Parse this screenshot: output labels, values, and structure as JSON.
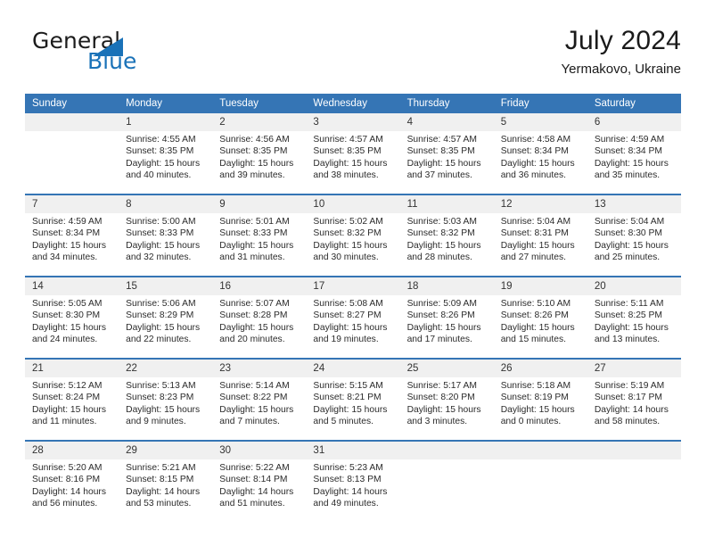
{
  "brand": {
    "word1": "General",
    "word2": "Blue",
    "triangle_color": "#1a72b8",
    "blue_color": "#1a72b8"
  },
  "header": {
    "month_title": "July 2024",
    "location": "Yermakovo, Ukraine"
  },
  "theme": {
    "header_row_bg": "#3575b5",
    "date_band_bg": "#f0f0f0",
    "cell_bg": "#ffffff",
    "text_color": "#2b2b2b"
  },
  "calendar": {
    "weekday_headers": [
      "Sunday",
      "Monday",
      "Tuesday",
      "Wednesday",
      "Thursday",
      "Friday",
      "Saturday"
    ],
    "labels": {
      "sunrise": "Sunrise:",
      "sunset": "Sunset:",
      "daylight": "Daylight:"
    },
    "weeks": [
      [
        {
          "day": "",
          "blank": true,
          "l1": "",
          "l2": "",
          "l3": "",
          "l4": ""
        },
        {
          "day": "1",
          "l1": "Sunrise: 4:55 AM",
          "l2": "Sunset: 8:35 PM",
          "l3": "Daylight: 15 hours",
          "l4": "and 40 minutes."
        },
        {
          "day": "2",
          "l1": "Sunrise: 4:56 AM",
          "l2": "Sunset: 8:35 PM",
          "l3": "Daylight: 15 hours",
          "l4": "and 39 minutes."
        },
        {
          "day": "3",
          "l1": "Sunrise: 4:57 AM",
          "l2": "Sunset: 8:35 PM",
          "l3": "Daylight: 15 hours",
          "l4": "and 38 minutes."
        },
        {
          "day": "4",
          "l1": "Sunrise: 4:57 AM",
          "l2": "Sunset: 8:35 PM",
          "l3": "Daylight: 15 hours",
          "l4": "and 37 minutes."
        },
        {
          "day": "5",
          "l1": "Sunrise: 4:58 AM",
          "l2": "Sunset: 8:34 PM",
          "l3": "Daylight: 15 hours",
          "l4": "and 36 minutes."
        },
        {
          "day": "6",
          "l1": "Sunrise: 4:59 AM",
          "l2": "Sunset: 8:34 PM",
          "l3": "Daylight: 15 hours",
          "l4": "and 35 minutes."
        }
      ],
      [
        {
          "day": "7",
          "l1": "Sunrise: 4:59 AM",
          "l2": "Sunset: 8:34 PM",
          "l3": "Daylight: 15 hours",
          "l4": "and 34 minutes."
        },
        {
          "day": "8",
          "l1": "Sunrise: 5:00 AM",
          "l2": "Sunset: 8:33 PM",
          "l3": "Daylight: 15 hours",
          "l4": "and 32 minutes."
        },
        {
          "day": "9",
          "l1": "Sunrise: 5:01 AM",
          "l2": "Sunset: 8:33 PM",
          "l3": "Daylight: 15 hours",
          "l4": "and 31 minutes."
        },
        {
          "day": "10",
          "l1": "Sunrise: 5:02 AM",
          "l2": "Sunset: 8:32 PM",
          "l3": "Daylight: 15 hours",
          "l4": "and 30 minutes."
        },
        {
          "day": "11",
          "l1": "Sunrise: 5:03 AM",
          "l2": "Sunset: 8:32 PM",
          "l3": "Daylight: 15 hours",
          "l4": "and 28 minutes."
        },
        {
          "day": "12",
          "l1": "Sunrise: 5:04 AM",
          "l2": "Sunset: 8:31 PM",
          "l3": "Daylight: 15 hours",
          "l4": "and 27 minutes."
        },
        {
          "day": "13",
          "l1": "Sunrise: 5:04 AM",
          "l2": "Sunset: 8:30 PM",
          "l3": "Daylight: 15 hours",
          "l4": "and 25 minutes."
        }
      ],
      [
        {
          "day": "14",
          "l1": "Sunrise: 5:05 AM",
          "l2": "Sunset: 8:30 PM",
          "l3": "Daylight: 15 hours",
          "l4": "and 24 minutes."
        },
        {
          "day": "15",
          "l1": "Sunrise: 5:06 AM",
          "l2": "Sunset: 8:29 PM",
          "l3": "Daylight: 15 hours",
          "l4": "and 22 minutes."
        },
        {
          "day": "16",
          "l1": "Sunrise: 5:07 AM",
          "l2": "Sunset: 8:28 PM",
          "l3": "Daylight: 15 hours",
          "l4": "and 20 minutes."
        },
        {
          "day": "17",
          "l1": "Sunrise: 5:08 AM",
          "l2": "Sunset: 8:27 PM",
          "l3": "Daylight: 15 hours",
          "l4": "and 19 minutes."
        },
        {
          "day": "18",
          "l1": "Sunrise: 5:09 AM",
          "l2": "Sunset: 8:26 PM",
          "l3": "Daylight: 15 hours",
          "l4": "and 17 minutes."
        },
        {
          "day": "19",
          "l1": "Sunrise: 5:10 AM",
          "l2": "Sunset: 8:26 PM",
          "l3": "Daylight: 15 hours",
          "l4": "and 15 minutes."
        },
        {
          "day": "20",
          "l1": "Sunrise: 5:11 AM",
          "l2": "Sunset: 8:25 PM",
          "l3": "Daylight: 15 hours",
          "l4": "and 13 minutes."
        }
      ],
      [
        {
          "day": "21",
          "l1": "Sunrise: 5:12 AM",
          "l2": "Sunset: 8:24 PM",
          "l3": "Daylight: 15 hours",
          "l4": "and 11 minutes."
        },
        {
          "day": "22",
          "l1": "Sunrise: 5:13 AM",
          "l2": "Sunset: 8:23 PM",
          "l3": "Daylight: 15 hours",
          "l4": "and 9 minutes."
        },
        {
          "day": "23",
          "l1": "Sunrise: 5:14 AM",
          "l2": "Sunset: 8:22 PM",
          "l3": "Daylight: 15 hours",
          "l4": "and 7 minutes."
        },
        {
          "day": "24",
          "l1": "Sunrise: 5:15 AM",
          "l2": "Sunset: 8:21 PM",
          "l3": "Daylight: 15 hours",
          "l4": "and 5 minutes."
        },
        {
          "day": "25",
          "l1": "Sunrise: 5:17 AM",
          "l2": "Sunset: 8:20 PM",
          "l3": "Daylight: 15 hours",
          "l4": "and 3 minutes."
        },
        {
          "day": "26",
          "l1": "Sunrise: 5:18 AM",
          "l2": "Sunset: 8:19 PM",
          "l3": "Daylight: 15 hours",
          "l4": "and 0 minutes."
        },
        {
          "day": "27",
          "l1": "Sunrise: 5:19 AM",
          "l2": "Sunset: 8:17 PM",
          "l3": "Daylight: 14 hours",
          "l4": "and 58 minutes."
        }
      ],
      [
        {
          "day": "28",
          "l1": "Sunrise: 5:20 AM",
          "l2": "Sunset: 8:16 PM",
          "l3": "Daylight: 14 hours",
          "l4": "and 56 minutes."
        },
        {
          "day": "29",
          "l1": "Sunrise: 5:21 AM",
          "l2": "Sunset: 8:15 PM",
          "l3": "Daylight: 14 hours",
          "l4": "and 53 minutes."
        },
        {
          "day": "30",
          "l1": "Sunrise: 5:22 AM",
          "l2": "Sunset: 8:14 PM",
          "l3": "Daylight: 14 hours",
          "l4": "and 51 minutes."
        },
        {
          "day": "31",
          "l1": "Sunrise: 5:23 AM",
          "l2": "Sunset: 8:13 PM",
          "l3": "Daylight: 14 hours",
          "l4": "and 49 minutes."
        },
        {
          "day": "",
          "blank": true,
          "trailing": true,
          "l1": "",
          "l2": "",
          "l3": "",
          "l4": ""
        },
        {
          "day": "",
          "blank": true,
          "trailing": true,
          "l1": "",
          "l2": "",
          "l3": "",
          "l4": ""
        },
        {
          "day": "",
          "blank": true,
          "trailing": true,
          "l1": "",
          "l2": "",
          "l3": "",
          "l4": ""
        }
      ]
    ]
  }
}
